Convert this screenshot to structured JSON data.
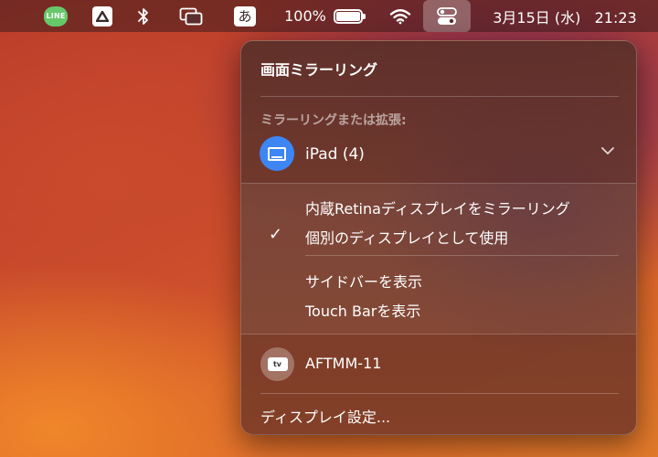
{
  "menubar": {
    "line_icon_text": "LINE",
    "ime_char": "あ",
    "battery_percent": "100%",
    "battery_level": 1.0,
    "datetime": "3月15日 (水)   21:23",
    "icons": [
      "line-icon",
      "google-drive-icon",
      "bluetooth-icon",
      "screen-mirroring-icon",
      "input-method-icon",
      "battery-icon",
      "wifi-icon",
      "control-center-icon"
    ]
  },
  "panel": {
    "title": "画面ミラーリング",
    "section_header": "ミラーリングまたは拡張:",
    "device": {
      "name": "iPad (4)",
      "icon": "ipad-icon",
      "accent_color": "#3d86f4"
    },
    "options": [
      {
        "label": "内蔵Retinaディスプレイをミラーリング",
        "checked": false
      },
      {
        "label": "個別のディスプレイとして使用",
        "checked": true
      },
      {
        "label": "サイドバーを表示",
        "checked": false
      },
      {
        "label": "Touch Barを表示",
        "checked": false
      }
    ],
    "appletv": {
      "name": "AFTMM-11",
      "icon": "apple-tv-icon",
      "icon_text": "tv"
    },
    "settings_label": "ディスプレイ設定..."
  }
}
